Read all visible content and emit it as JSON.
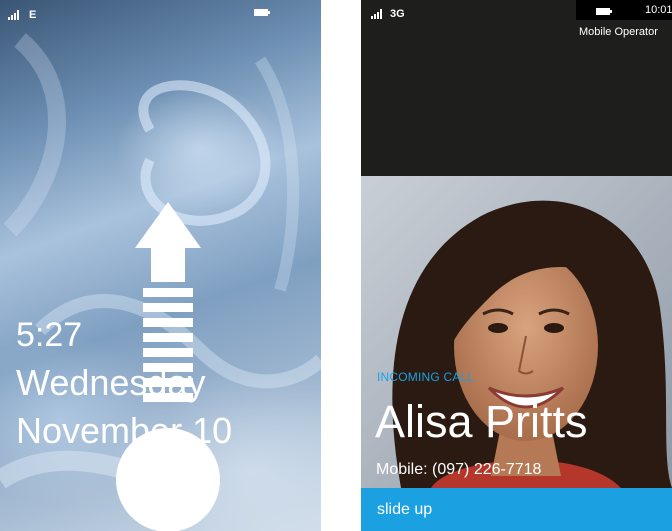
{
  "lock_screen": {
    "status": {
      "network": "E",
      "signal_icon": "signal-icon",
      "battery_icon": "battery-icon"
    },
    "time": "5:27",
    "day": "Wednesday",
    "date": "November 10",
    "unlock_arrow_icon": "arrow-up-icon"
  },
  "call_screen": {
    "status": {
      "network": "3G",
      "time": "10:01",
      "operator": "Mobile Operator",
      "signal_icon": "signal-icon",
      "battery_icon": "battery-icon"
    },
    "incoming_label": "INCOMING CALL",
    "caller_name": "Alisa Pritts",
    "caller_number": "Mobile: (097) 226-7718",
    "slide_label": "slide up",
    "accent_color": "#1ba1e2"
  }
}
